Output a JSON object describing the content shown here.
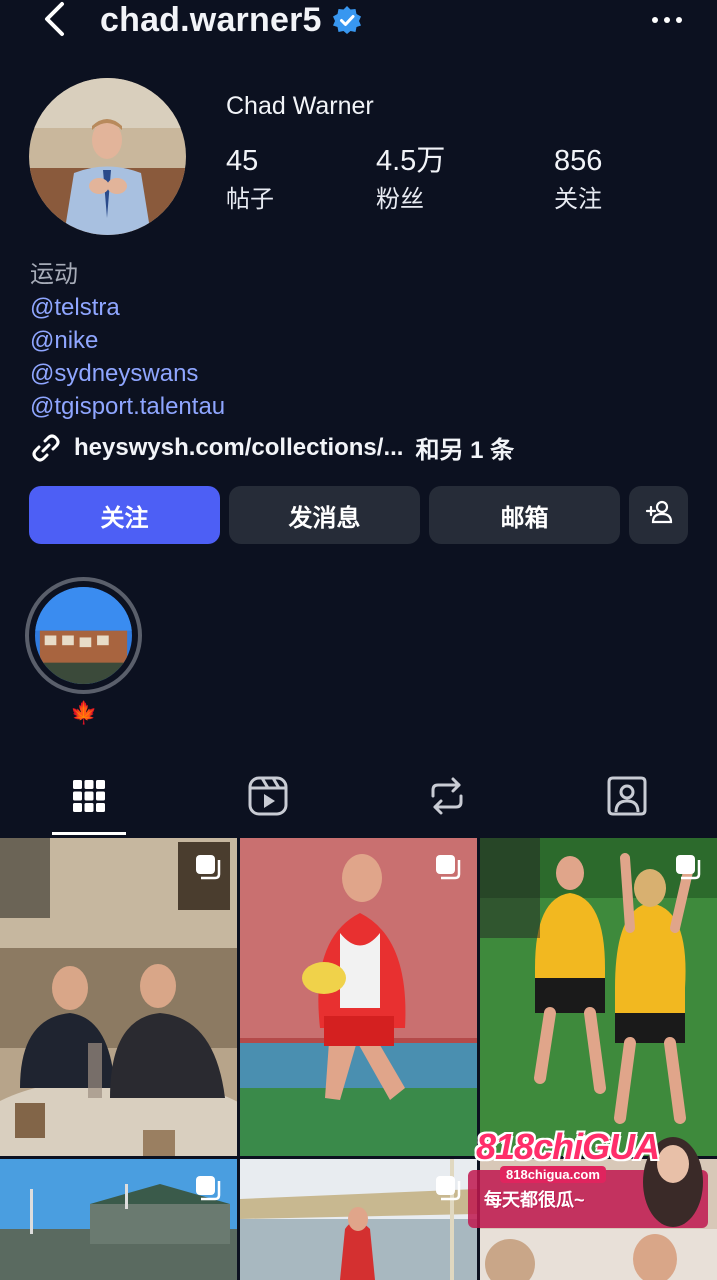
{
  "header": {
    "username": "chad.warner5",
    "verified": true,
    "icons": {
      "back": "back-arrow-icon",
      "more": "more-dots-icon",
      "verified": "verified-badge-icon"
    }
  },
  "profile": {
    "full_name": "Chad Warner",
    "stats": [
      {
        "value": "45",
        "label": "帖子"
      },
      {
        "value": "4.5万",
        "label": "粉丝"
      },
      {
        "value": "856",
        "label": "关注"
      }
    ],
    "bio": {
      "category": "运动",
      "mentions": [
        "@telstra",
        "@nike",
        "@sydneyswans",
        "@tgisport.talentau"
      ]
    },
    "link": {
      "url_text": "heyswysh.com/collections/...",
      "more_text": "和另 1 条"
    }
  },
  "actions": {
    "follow": "关注",
    "message": "发消息",
    "email": "邮箱",
    "add_user_icon": "add-user-icon"
  },
  "highlights": [
    {
      "label": "🍁"
    }
  ],
  "tabs": [
    {
      "name": "posts",
      "icon": "grid-icon",
      "active": true
    },
    {
      "name": "reels",
      "icon": "reels-icon",
      "active": false
    },
    {
      "name": "reposts",
      "icon": "repost-icon",
      "active": false
    },
    {
      "name": "tagged",
      "icon": "tagged-person-icon",
      "active": false
    }
  ],
  "ad": {
    "title": "818chiGUA",
    "site": "818chigua.com",
    "line": "每天都很瓜~"
  },
  "colors": {
    "background": "#0c1120",
    "accent": "#4d5ff5",
    "mention": "#8fa6ff",
    "button_secondary": "#262c38",
    "verified": "#3897f0"
  }
}
